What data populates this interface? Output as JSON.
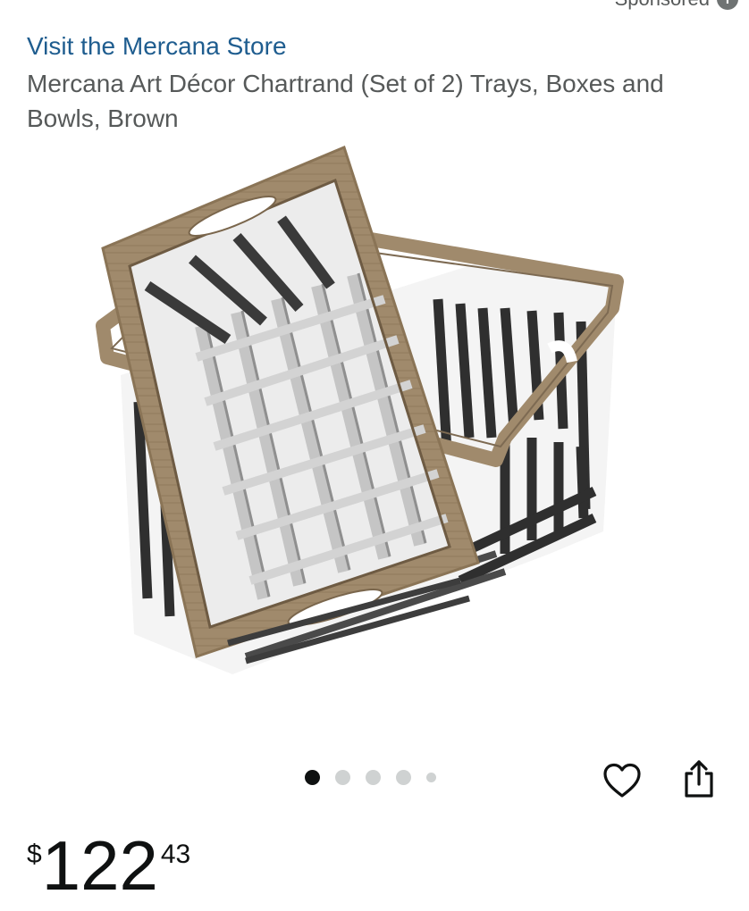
{
  "header": {
    "sponsored_label": "Sponsored",
    "info_icon": "i"
  },
  "store": {
    "link_text": "Visit the Mercana Store"
  },
  "product": {
    "title": "Mercana Art Décor Chartrand (Set of 2) Trays, Boxes and Bowls, Brown",
    "image_alt": "Two wooden-framed metal lattice trays stacked at an angle"
  },
  "gallery": {
    "total_images": 5,
    "active_index": 0
  },
  "actions": {
    "heart_icon": "heart-icon",
    "share_icon": "share-icon"
  },
  "price": {
    "symbol": "$",
    "whole": "122",
    "fraction": "43"
  },
  "colors": {
    "link": "#1f5d8f",
    "text_primary": "#0f1111",
    "text_secondary": "#565959",
    "dot_active": "#0f1111",
    "dot_inactive": "#cfd2d2"
  }
}
